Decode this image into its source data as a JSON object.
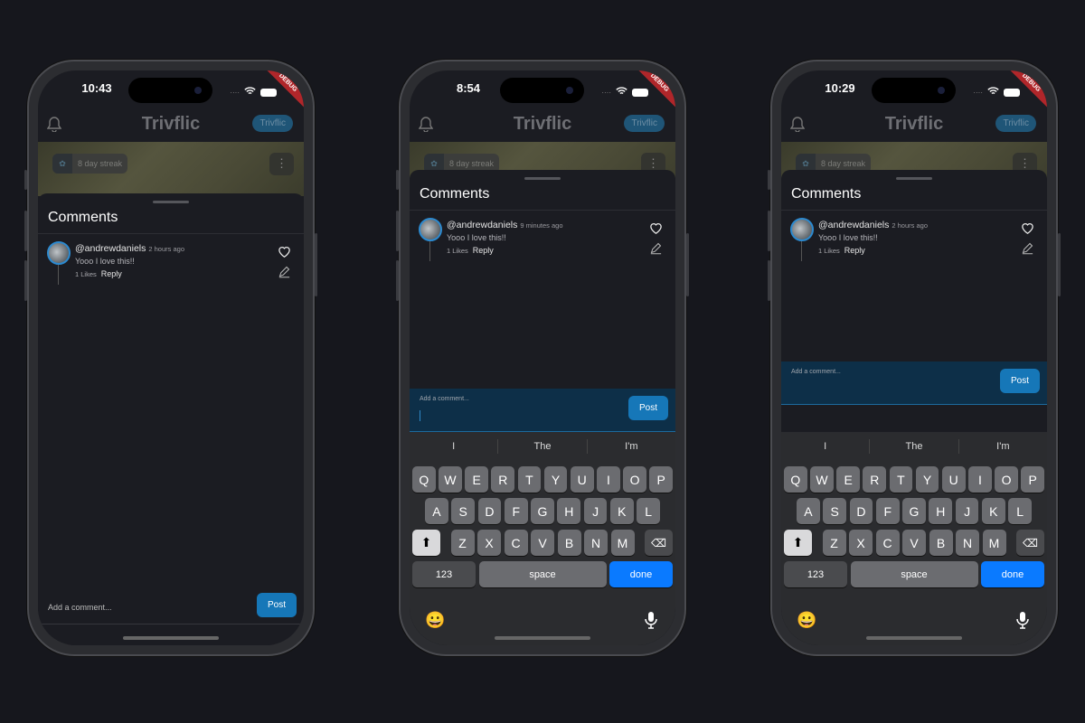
{
  "app": {
    "title": "Trivflic",
    "header_button": "Trivflic",
    "streak": "8 day streak",
    "debug_banner": "DEBUG",
    "comments_title": "Comments",
    "input_placeholder": "Add a comment...",
    "post_label": "Post"
  },
  "colors": {
    "accent": "#1677b8",
    "input_focus_bg": "#0d2f48",
    "done_key": "#0a7aff",
    "debug": "#b0262a"
  },
  "phones": [
    {
      "time": "10:43",
      "state": "collapsed",
      "comment": {
        "user": "@andrewdaniels",
        "ago": "2 hours ago",
        "text": "Yooo I love this!!",
        "likes": "1 Likes",
        "reply": "Reply"
      }
    },
    {
      "time": "8:54",
      "state": "keyboard-focused",
      "comment": {
        "user": "@andrewdaniels",
        "ago": "9 minutes ago",
        "text": "Yooo I love this!!",
        "likes": "1 Likes",
        "reply": "Reply"
      }
    },
    {
      "time": "10:29",
      "state": "keyboard",
      "comment": {
        "user": "@andrewdaniels",
        "ago": "2 hours ago",
        "text": "Yooo I love this!!",
        "likes": "1 Likes",
        "reply": "Reply"
      }
    }
  ],
  "keyboard": {
    "suggestions": [
      "I",
      "The",
      "I'm"
    ],
    "row1": [
      "Q",
      "W",
      "E",
      "R",
      "T",
      "Y",
      "U",
      "I",
      "O",
      "P"
    ],
    "row2": [
      "A",
      "S",
      "D",
      "F",
      "G",
      "H",
      "J",
      "K",
      "L"
    ],
    "row3": [
      "Z",
      "X",
      "C",
      "V",
      "B",
      "N",
      "M"
    ],
    "numbers": "123",
    "space": "space",
    "done": "done"
  },
  "icons": [
    "bell-icon",
    "wifi-icon",
    "battery-icon",
    "brain-icon",
    "more-vertical-icon",
    "heart-icon",
    "pencil-icon",
    "shift-icon",
    "backspace-icon",
    "emoji-icon",
    "microphone-icon"
  ]
}
